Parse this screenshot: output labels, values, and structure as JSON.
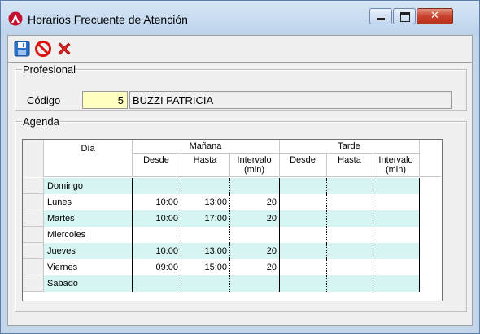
{
  "window": {
    "title": "Horarios Frecuente de Atención",
    "accent_close": "#c7412c"
  },
  "toolbar": {
    "save": "save-icon",
    "cancel": "cancel-icon",
    "delete": "delete-icon"
  },
  "profesional": {
    "legend": "Profesional",
    "codigo_label": "Código",
    "codigo_value": "5",
    "nombre": "BUZZI PATRICIA"
  },
  "agenda": {
    "legend": "Agenda",
    "headers": {
      "dia": "Día",
      "manana": "Mañana",
      "tarde": "Tarde",
      "desde": "Desde",
      "hasta": "Hasta",
      "intervalo": "Intervalo",
      "min": "(min)"
    },
    "rows": [
      {
        "dia": "Domingo",
        "m_desde": "",
        "m_hasta": "",
        "m_intervalo": "",
        "t_desde": "",
        "t_hasta": "",
        "t_intervalo": ""
      },
      {
        "dia": "Lunes",
        "m_desde": "10:00",
        "m_hasta": "13:00",
        "m_intervalo": "20",
        "t_desde": "",
        "t_hasta": "",
        "t_intervalo": ""
      },
      {
        "dia": "Martes",
        "m_desde": "10:00",
        "m_hasta": "17:00",
        "m_intervalo": "20",
        "t_desde": "",
        "t_hasta": "",
        "t_intervalo": ""
      },
      {
        "dia": "Miercoles",
        "m_desde": "",
        "m_hasta": "",
        "m_intervalo": "",
        "t_desde": "",
        "t_hasta": "",
        "t_intervalo": ""
      },
      {
        "dia": "Jueves",
        "m_desde": "10:00",
        "m_hasta": "13:00",
        "m_intervalo": "20",
        "t_desde": "",
        "t_hasta": "",
        "t_intervalo": ""
      },
      {
        "dia": "Viernes",
        "m_desde": "09:00",
        "m_hasta": "15:00",
        "m_intervalo": "20",
        "t_desde": "",
        "t_hasta": "",
        "t_intervalo": ""
      },
      {
        "dia": "Sabado",
        "m_desde": "",
        "m_hasta": "",
        "m_intervalo": "",
        "t_desde": "",
        "t_hasta": "",
        "t_intervalo": ""
      }
    ],
    "alt_row_color": "#d6f4f2"
  }
}
